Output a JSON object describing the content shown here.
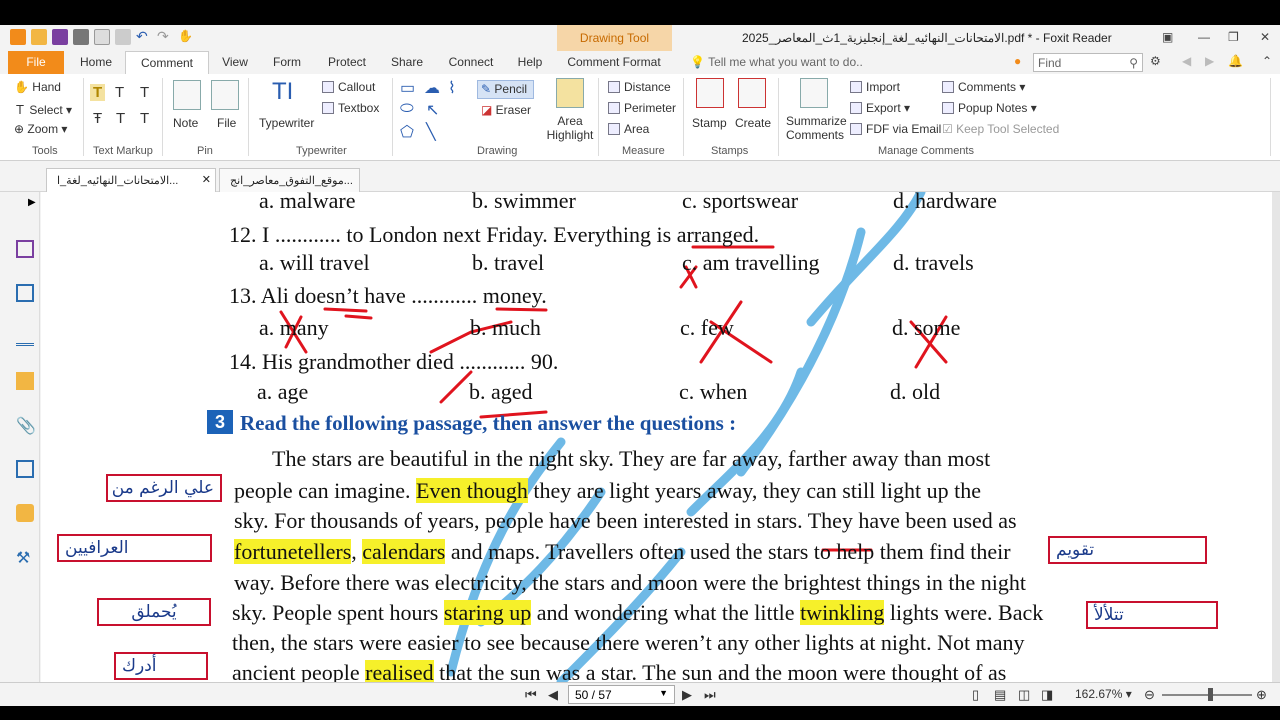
{
  "window": {
    "title": "الامتحانات_النهائيه_لغة_إنجليزية_1ث_المعاصر_2025.pdf * - Foxit Reader",
    "context_tab": "Drawing Tool"
  },
  "ribbon_tabs": [
    "File",
    "Home",
    "Comment",
    "View",
    "Form",
    "Protect",
    "Share",
    "Connect",
    "Help",
    "Comment Format"
  ],
  "active_tab": "Comment",
  "tell_me": "Tell me what you want to do..",
  "find_placeholder": "Find",
  "ribbon": {
    "tools": {
      "hand": "Hand",
      "select": "Select",
      "zoom": "Zoom",
      "label": "Tools"
    },
    "text_markup": {
      "label": "Text Markup"
    },
    "pin": {
      "note": "Note",
      "file": "File",
      "label": "Pin"
    },
    "typewriter": {
      "typewriter": "Typewriter",
      "callout": "Callout",
      "textbox": "Textbox",
      "label": "Typewriter"
    },
    "drawing": {
      "pencil": "Pencil",
      "eraser": "Eraser",
      "area_highlight": "Area Highlight",
      "label": "Drawing"
    },
    "measure": {
      "distance": "Distance",
      "perimeter": "Perimeter",
      "area": "Area",
      "label": "Measure"
    },
    "stamps": {
      "stamp": "Stamp",
      "create": "Create",
      "label": "Stamps"
    },
    "manage": {
      "summarize": "Summarize Comments",
      "import": "Import",
      "export": "Export",
      "fdf_email": "FDF via Email",
      "comments": "Comments",
      "popup_notes": "Popup Notes",
      "keep_tool": "Keep Tool Selected",
      "label": "Manage Comments"
    }
  },
  "doc_tabs": [
    "الامتحانات_النهائيه_لغة_ا...",
    "موقع_التفوق_معاصر_انج..."
  ],
  "doc": {
    "line_prev": {
      "a": "a. malware",
      "b": "b. swimmer",
      "c": "c. sportswear",
      "d": "d. hardware"
    },
    "q12": {
      "q": "12. I ............ to London next Friday. Everything is arranged.",
      "a": "a. will travel",
      "b": "b. travel",
      "c": "c. am travelling",
      "d": "d. travels"
    },
    "q13": {
      "q": "13. Ali doesn’t have ............ money.",
      "a": "a. many",
      "b": "b. much",
      "c": "c. few",
      "d": "d. some"
    },
    "q14": {
      "q": "14. His grandmother died ............ 90.",
      "a": "a. age",
      "b": "b. aged",
      "c": "c. when",
      "d": "d. old"
    },
    "section_num": "3",
    "section_title": "Read the following passage, then answer the questions :",
    "passage": {
      "l1": "The stars are beautiful in the night sky. They are far away, farther away than most",
      "l2a": "people can imagine. ",
      "l2h": "Even though",
      "l2b": " they are light years away, they can still light up the",
      "l3": "sky. For thousands of years, people have been interested in stars. They have been used as",
      "l4h1": "fortunetellers",
      "l4m": ", ",
      "l4h2": "calendars",
      "l4b": " and maps. Travellers often used the stars to help them find their",
      "l5": "way. Before there was electricity, the stars and moon were the brightest things in the night",
      "l6a": "sky. People spent hours ",
      "l6h1": "staring up",
      "l6m": " and wondering what the little ",
      "l6h2": "twinkling",
      "l6b": " lights were. Back",
      "l7": "then, the stars were easier to see because there weren’t any other lights at night. Not many",
      "l8a": "ancient people ",
      "l8h": "realised",
      "l8b": " that the sun was a star. The sun and the moon were thought of as"
    },
    "notes": {
      "even_though": "علي الرغم من",
      "fortunetellers": "العرافيين",
      "staring": "يُحملق",
      "realised": "أدرك",
      "calendars": "تقويم",
      "twinkling": "تتلألأ"
    }
  },
  "status": {
    "page": "50 / 57",
    "zoom": "162.67%"
  },
  "colors": {
    "accent": "#f28b1a",
    "highlight": "#f6f02a",
    "pen": "#e0141e",
    "watermark": "#4aa8e0"
  }
}
